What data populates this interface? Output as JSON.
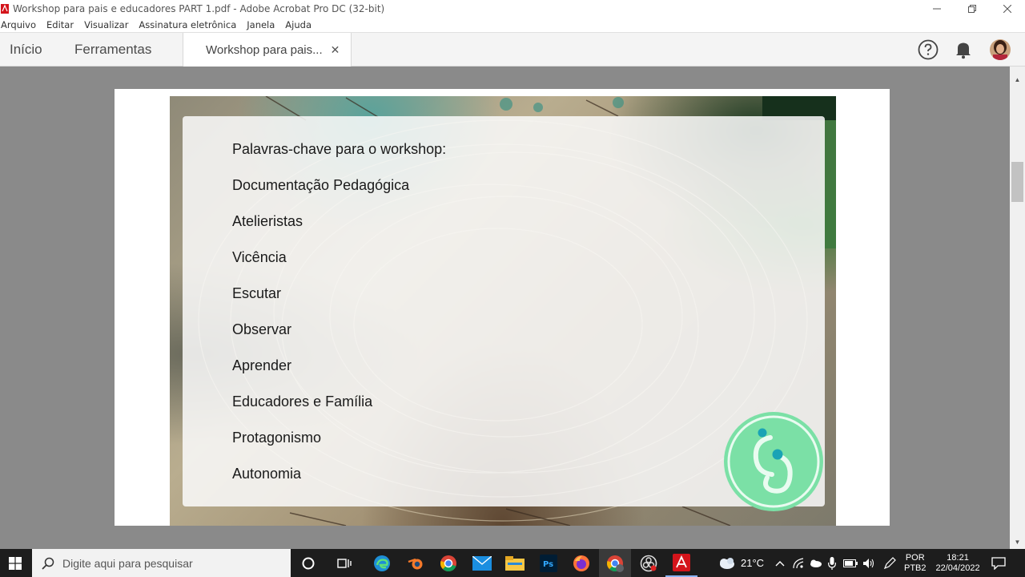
{
  "window": {
    "title": "Workshop para pais e educadores PART 1.pdf - Adobe Acrobat Pro DC (32-bit)"
  },
  "menu": [
    "Arquivo",
    "Editar",
    "Visualizar",
    "Assinatura eletrônica",
    "Janela",
    "Ajuda"
  ],
  "tabs": {
    "home": "Início",
    "tools": "Ferramentas",
    "document": "Workshop para pais..."
  },
  "slide": {
    "title": "Palavras-chave para o workshop:",
    "keywords": [
      "Documentação Pedagógica",
      "Atelieristas",
      "Vicência",
      "Escutar",
      "Observar",
      "Aprender",
      "Educadores e Família",
      "Protagonismo",
      "Autonomia"
    ]
  },
  "taskbar": {
    "search_placeholder": "Digite aqui para pesquisar",
    "weather": "21°C",
    "language_line1": "POR",
    "language_line2": "PTB2",
    "time": "18:21",
    "date": "22/04/2022"
  },
  "colors": {
    "logo_green": "#7be0a6",
    "logo_dot": "#1aa3b5",
    "acrobat_red": "#d4141b"
  }
}
